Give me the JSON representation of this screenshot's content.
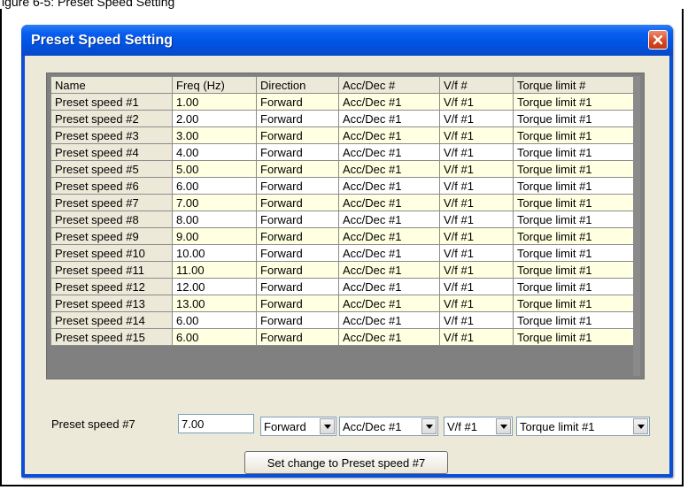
{
  "caption": "igure 6-5: Preset Speed Setting",
  "window": {
    "title": "Preset Speed Setting"
  },
  "grid": {
    "columns": [
      "Name",
      "Freq (Hz)",
      "Direction",
      "Acc/Dec #",
      "V/f #",
      "Torque limit #"
    ],
    "rows": [
      [
        "Preset speed #1",
        "1.00",
        "Forward",
        "Acc/Dec #1",
        "V/f #1",
        "Torque limit #1"
      ],
      [
        "Preset speed #2",
        "2.00",
        "Forward",
        "Acc/Dec #1",
        "V/f #1",
        "Torque limit #1"
      ],
      [
        "Preset speed #3",
        "3.00",
        "Forward",
        "Acc/Dec #1",
        "V/f #1",
        "Torque limit #1"
      ],
      [
        "Preset speed #4",
        "4.00",
        "Forward",
        "Acc/Dec #1",
        "V/f #1",
        "Torque limit #1"
      ],
      [
        "Preset speed #5",
        "5.00",
        "Forward",
        "Acc/Dec #1",
        "V/f #1",
        "Torque limit #1"
      ],
      [
        "Preset speed #6",
        "6.00",
        "Forward",
        "Acc/Dec #1",
        "V/f #1",
        "Torque limit #1"
      ],
      [
        "Preset speed #7",
        "7.00",
        "Forward",
        "Acc/Dec #1",
        "V/f #1",
        "Torque limit #1"
      ],
      [
        "Preset speed #8",
        "8.00",
        "Forward",
        "Acc/Dec #1",
        "V/f #1",
        "Torque limit #1"
      ],
      [
        "Preset speed #9",
        "9.00",
        "Forward",
        "Acc/Dec #1",
        "V/f #1",
        "Torque limit #1"
      ],
      [
        "Preset speed #10",
        "10.00",
        "Forward",
        "Acc/Dec #1",
        "V/f #1",
        "Torque limit #1"
      ],
      [
        "Preset speed #11",
        "11.00",
        "Forward",
        "Acc/Dec #1",
        "V/f #1",
        "Torque limit #1"
      ],
      [
        "Preset speed #12",
        "12.00",
        "Forward",
        "Acc/Dec #1",
        "V/f #1",
        "Torque limit #1"
      ],
      [
        "Preset speed #13",
        "13.00",
        "Forward",
        "Acc/Dec #1",
        "V/f #1",
        "Torque limit #1"
      ],
      [
        "Preset speed #14",
        "6.00",
        "Forward",
        "Acc/Dec #1",
        "V/f #1",
        "Torque limit #1"
      ],
      [
        "Preset speed #15",
        "6.00",
        "Forward",
        "Acc/Dec #1",
        "V/f #1",
        "Torque limit #1"
      ]
    ]
  },
  "editor": {
    "label": "Preset speed #7",
    "freq_value": "7.00",
    "direction": "Forward",
    "accdec": "Acc/Dec #1",
    "vf": "V/f #1",
    "torque": "Torque limit #1"
  },
  "set_button_label": "Set change to Preset speed #7",
  "colors": {
    "title_bar": "#0054e3",
    "odd_row": "#ffffe1",
    "close_button": "#d8451f"
  }
}
